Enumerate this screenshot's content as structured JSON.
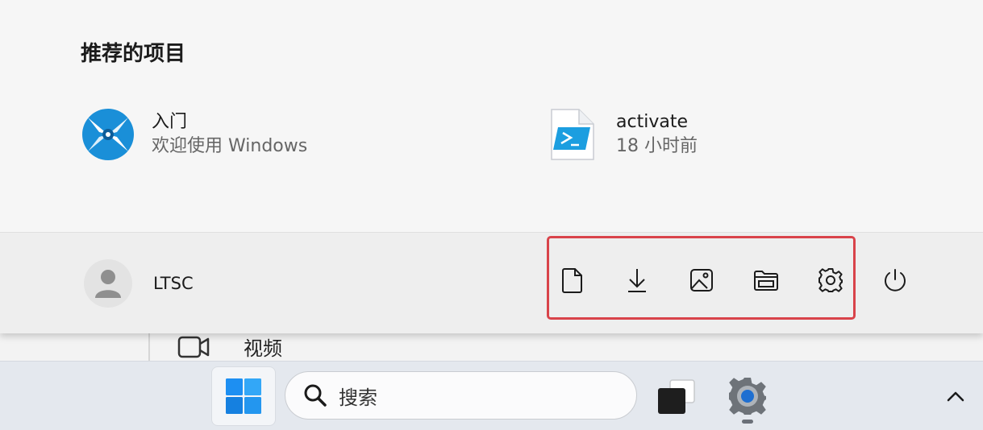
{
  "background_window": {
    "row_label": "视频"
  },
  "recommended": {
    "title": "推荐的项目",
    "items": [
      {
        "name": "入门",
        "subtitle": "欢迎使用 Windows",
        "icon": "get-started-icon"
      },
      {
        "name": "activate",
        "subtitle": "18 小时前",
        "icon": "powershell-script-icon"
      }
    ]
  },
  "footer": {
    "user_name": "LTSC",
    "folder_buttons": [
      {
        "icon": "documents-icon"
      },
      {
        "icon": "downloads-icon"
      },
      {
        "icon": "pictures-icon"
      },
      {
        "icon": "file-explorer-icon"
      },
      {
        "icon": "settings-icon"
      }
    ],
    "power_icon": "power-icon",
    "highlight_color": "#d9434a"
  },
  "taskbar": {
    "search_placeholder": "搜索",
    "accent": "#1f6fd1"
  }
}
